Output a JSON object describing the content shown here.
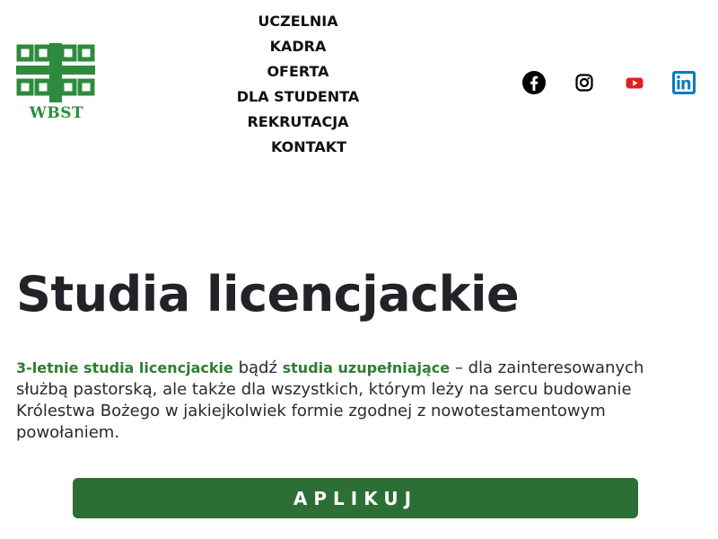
{
  "logo": {
    "text": "WBST",
    "icon": "cross-ornament-logo",
    "color": "#2e8b3e"
  },
  "nav": {
    "items": [
      "UCZELNIA",
      "KADRA",
      "OFERTA",
      "DLA STUDENTA",
      "REKRUTACJA",
      "KONTAKT"
    ]
  },
  "social": [
    {
      "icon": "facebook-icon",
      "color": "#000000"
    },
    {
      "icon": "instagram-icon",
      "color": "#000000"
    },
    {
      "icon": "youtube-icon",
      "color": "#e02020"
    },
    {
      "icon": "linkedin-icon",
      "color": "#0a7bc1"
    }
  ],
  "main": {
    "title": "Studia licencjackie",
    "intro": {
      "link1": "3-letnie studia licencjackie",
      "mid1": " bądź ",
      "link2": "studia uzupełniające",
      "rest": " – dla zainteresowanych służbą pastorską, ale także dla wszystkich, którym leży na sercu budowanie Królestwa Bożego w jakiejkolwiek formie zgodnej z nowotestamentowym powołaniem."
    },
    "apply_label": "APLIKUJ"
  },
  "colors": {
    "accent": "#2f7d32",
    "button": "#2c6e33",
    "title": "#222228"
  }
}
